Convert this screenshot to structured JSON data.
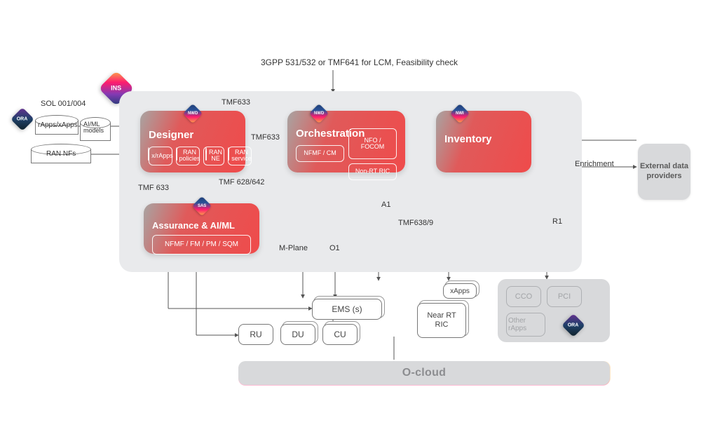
{
  "top_label": "3GPP 531/532 or TMF641 for LCM, Feasibility check",
  "badges": {
    "ins": "INS",
    "ora": "ORA",
    "nwd": "NWD",
    "nwi": "NWI",
    "sas": "SAS"
  },
  "left_inputs": {
    "sol_label": "SOL 001/004",
    "db1": "rApps/xApps",
    "db2": "AI/ML models",
    "db3": "RAN NFs"
  },
  "designer": {
    "title": "Designer",
    "chips": [
      "x/rApps",
      "RAN policies",
      "RAN NE",
      "RAN service"
    ]
  },
  "orchestration": {
    "title": "Orchestration",
    "nfo": "NFO / FOCOM",
    "nfmf": "NFMF / CM",
    "nonrt": "Non-RT RIC"
  },
  "inventory": {
    "title": "Inventory"
  },
  "assurance": {
    "title": "Assurance & AI/ML",
    "chip": "NFMF / FM / PM / SQM"
  },
  "edges": {
    "tmf633_a": "TMF633",
    "tmf633_b": "TMF633",
    "tmf633_c": "TMF 633",
    "tmf628": "TMF 628/642",
    "mplane": "M-Plane",
    "o1": "O1",
    "a1": "A1",
    "tmf638": "TMF638/9",
    "r1": "R1",
    "enrichment": "Enrichment"
  },
  "nodes": {
    "ems": "EMS (s)",
    "ru": "RU",
    "du": "DU",
    "cu": "CU",
    "xapps": "xApps",
    "near_rt": "Near RT RIC"
  },
  "rapps": {
    "cco": "CCO",
    "pci": "PCI",
    "other": "Other rApps"
  },
  "external": "External data providers",
  "ocloud": "O-cloud"
}
